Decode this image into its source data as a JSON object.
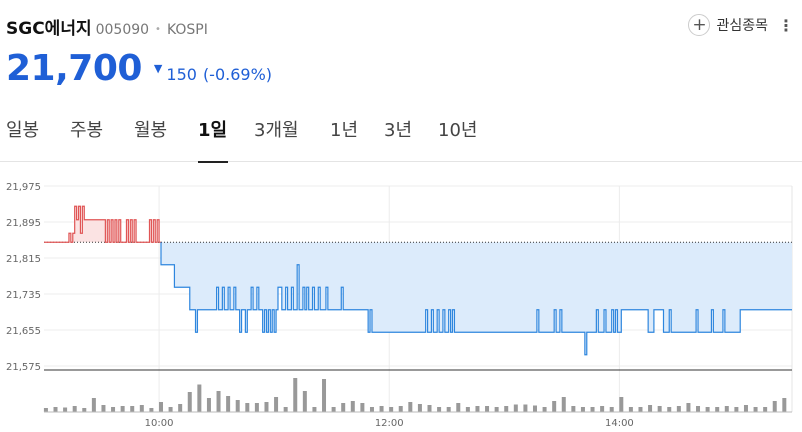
{
  "stock": {
    "name": "SGC에너지",
    "code": "005090",
    "market": "KOSPI",
    "favorite_label": "관심종목"
  },
  "price": {
    "current": "21,700",
    "change": "150",
    "change_pct": "(-0.69%)",
    "direction": "down"
  },
  "tabs": [
    {
      "label": "일봉",
      "active": false
    },
    {
      "label": "주봉",
      "active": false
    },
    {
      "label": "월봉",
      "active": false
    },
    {
      "label": "1일",
      "active": true
    },
    {
      "label": "3개월",
      "active": false
    },
    {
      "label": "1년",
      "active": false
    },
    {
      "label": "3년",
      "active": false
    },
    {
      "label": "10년",
      "active": false
    }
  ],
  "colors": {
    "price_blue": "#1f5fd6",
    "up_red": "#e05555",
    "down_blue": "#2e86de",
    "fill_blue": "#dcebfb",
    "fill_red": "#fbe3e3",
    "volume": "#999999"
  },
  "chart_data": {
    "type": "line",
    "previous_close": 21850,
    "y_ticks": [
      "21,975",
      "21,895",
      "21,815",
      "21,735",
      "21,655",
      "21,575"
    ],
    "y_tick_values": [
      21975,
      21895,
      21815,
      21735,
      21655,
      21575
    ],
    "ylim": [
      21575,
      21975
    ],
    "x_ticks": [
      "10:00",
      "12:00",
      "14:00"
    ],
    "x_tick_minutes": [
      600,
      720,
      840
    ],
    "xlim": [
      540,
      930
    ],
    "series": [
      {
        "points": [
          [
            540,
            21850
          ],
          [
            553,
            21850
          ],
          [
            553,
            21870
          ],
          [
            554,
            21870
          ],
          [
            554,
            21850
          ],
          [
            555,
            21850
          ],
          [
            555,
            21870
          ],
          [
            556,
            21870
          ],
          [
            556,
            21930
          ],
          [
            557,
            21930
          ],
          [
            557,
            21900
          ],
          [
            558,
            21900
          ],
          [
            558,
            21930
          ],
          [
            559,
            21930
          ],
          [
            559,
            21870
          ],
          [
            560,
            21870
          ],
          [
            560,
            21930
          ],
          [
            561,
            21930
          ],
          [
            561,
            21900
          ],
          [
            572,
            21900
          ],
          [
            572,
            21850
          ],
          [
            573,
            21850
          ],
          [
            573,
            21900
          ],
          [
            574,
            21900
          ],
          [
            574,
            21850
          ],
          [
            575,
            21850
          ],
          [
            575,
            21900
          ],
          [
            576,
            21900
          ],
          [
            576,
            21850
          ],
          [
            577,
            21850
          ],
          [
            577,
            21900
          ],
          [
            578,
            21900
          ],
          [
            578,
            21850
          ],
          [
            579,
            21850
          ],
          [
            579,
            21900
          ],
          [
            580,
            21900
          ],
          [
            580,
            21850
          ],
          [
            583,
            21850
          ],
          [
            583,
            21900
          ],
          [
            584,
            21900
          ],
          [
            584,
            21850
          ],
          [
            585,
            21850
          ],
          [
            585,
            21900
          ],
          [
            586,
            21900
          ],
          [
            586,
            21850
          ],
          [
            587,
            21850
          ],
          [
            587,
            21900
          ],
          [
            588,
            21900
          ],
          [
            588,
            21850
          ],
          [
            595,
            21850
          ],
          [
            595,
            21900
          ],
          [
            596,
            21900
          ],
          [
            596,
            21850
          ],
          [
            597,
            21850
          ],
          [
            597,
            21900
          ],
          [
            598,
            21900
          ],
          [
            598,
            21850
          ],
          [
            599,
            21850
          ],
          [
            599,
            21900
          ],
          [
            600,
            21900
          ],
          [
            600,
            21850
          ],
          [
            601,
            21850
          ],
          [
            601,
            21800
          ],
          [
            608,
            21800
          ],
          [
            608,
            21750
          ],
          [
            616,
            21750
          ],
          [
            616,
            21700
          ],
          [
            619,
            21700
          ],
          [
            619,
            21650
          ],
          [
            620,
            21650
          ],
          [
            620,
            21700
          ],
          [
            630,
            21700
          ],
          [
            630,
            21750
          ],
          [
            631,
            21750
          ],
          [
            631,
            21700
          ],
          [
            633,
            21700
          ],
          [
            633,
            21750
          ],
          [
            634,
            21750
          ],
          [
            634,
            21700
          ],
          [
            636,
            21700
          ],
          [
            636,
            21750
          ],
          [
            637,
            21750
          ],
          [
            637,
            21700
          ],
          [
            639,
            21700
          ],
          [
            639,
            21750
          ],
          [
            640,
            21750
          ],
          [
            640,
            21700
          ],
          [
            642,
            21700
          ],
          [
            642,
            21650
          ],
          [
            643,
            21650
          ],
          [
            643,
            21700
          ],
          [
            645,
            21700
          ],
          [
            645,
            21650
          ],
          [
            646,
            21650
          ],
          [
            646,
            21700
          ],
          [
            648,
            21700
          ],
          [
            648,
            21750
          ],
          [
            649,
            21750
          ],
          [
            649,
            21700
          ],
          [
            651,
            21700
          ],
          [
            651,
            21750
          ],
          [
            652,
            21750
          ],
          [
            652,
            21700
          ],
          [
            654,
            21700
          ],
          [
            654,
            21650
          ],
          [
            655,
            21650
          ],
          [
            655,
            21700
          ],
          [
            656,
            21700
          ],
          [
            656,
            21650
          ],
          [
            657,
            21650
          ],
          [
            657,
            21700
          ],
          [
            658,
            21700
          ],
          [
            658,
            21650
          ],
          [
            659,
            21650
          ],
          [
            659,
            21700
          ],
          [
            660,
            21700
          ],
          [
            660,
            21650
          ],
          [
            661,
            21650
          ],
          [
            661,
            21700
          ],
          [
            662,
            21700
          ],
          [
            662,
            21750
          ],
          [
            664,
            21750
          ],
          [
            664,
            21700
          ],
          [
            666,
            21700
          ],
          [
            666,
            21750
          ],
          [
            667,
            21750
          ],
          [
            667,
            21700
          ],
          [
            669,
            21700
          ],
          [
            669,
            21750
          ],
          [
            670,
            21750
          ],
          [
            670,
            21700
          ],
          [
            672,
            21700
          ],
          [
            672,
            21800
          ],
          [
            673,
            21800
          ],
          [
            673,
            21700
          ],
          [
            675,
            21700
          ],
          [
            675,
            21750
          ],
          [
            676,
            21750
          ],
          [
            676,
            21700
          ],
          [
            677,
            21700
          ],
          [
            677,
            21750
          ],
          [
            678,
            21750
          ],
          [
            678,
            21700
          ],
          [
            680,
            21700
          ],
          [
            680,
            21750
          ],
          [
            681,
            21750
          ],
          [
            681,
            21700
          ],
          [
            683,
            21700
          ],
          [
            683,
            21750
          ],
          [
            684,
            21750
          ],
          [
            684,
            21700
          ],
          [
            687,
            21700
          ],
          [
            687,
            21750
          ],
          [
            688,
            21750
          ],
          [
            688,
            21700
          ],
          [
            695,
            21700
          ],
          [
            695,
            21750
          ],
          [
            696,
            21750
          ],
          [
            696,
            21700
          ],
          [
            709,
            21700
          ],
          [
            709,
            21650
          ],
          [
            710,
            21650
          ],
          [
            710,
            21700
          ],
          [
            711,
            21700
          ],
          [
            711,
            21650
          ],
          [
            739,
            21650
          ],
          [
            739,
            21700
          ],
          [
            740,
            21700
          ],
          [
            740,
            21650
          ],
          [
            742,
            21650
          ],
          [
            742,
            21700
          ],
          [
            743,
            21700
          ],
          [
            743,
            21650
          ],
          [
            745,
            21650
          ],
          [
            745,
            21700
          ],
          [
            746,
            21700
          ],
          [
            746,
            21650
          ],
          [
            748,
            21650
          ],
          [
            748,
            21700
          ],
          [
            749,
            21700
          ],
          [
            749,
            21650
          ],
          [
            751,
            21650
          ],
          [
            751,
            21700
          ],
          [
            752,
            21700
          ],
          [
            752,
            21650
          ],
          [
            753,
            21650
          ],
          [
            753,
            21700
          ],
          [
            754,
            21700
          ],
          [
            754,
            21650
          ],
          [
            797,
            21650
          ],
          [
            797,
            21700
          ],
          [
            798,
            21700
          ],
          [
            798,
            21650
          ],
          [
            806,
            21650
          ],
          [
            806,
            21700
          ],
          [
            807,
            21700
          ],
          [
            807,
            21650
          ],
          [
            809,
            21650
          ],
          [
            809,
            21700
          ],
          [
            810,
            21700
          ],
          [
            810,
            21650
          ],
          [
            822,
            21650
          ],
          [
            822,
            21600
          ],
          [
            823,
            21600
          ],
          [
            823,
            21650
          ],
          [
            828,
            21650
          ],
          [
            828,
            21700
          ],
          [
            829,
            21700
          ],
          [
            829,
            21650
          ],
          [
            832,
            21650
          ],
          [
            832,
            21700
          ],
          [
            833,
            21700
          ],
          [
            833,
            21650
          ],
          [
            836,
            21650
          ],
          [
            836,
            21700
          ],
          [
            837,
            21700
          ],
          [
            837,
            21650
          ],
          [
            838,
            21650
          ],
          [
            838,
            21700
          ],
          [
            839,
            21700
          ],
          [
            839,
            21650
          ],
          [
            841,
            21650
          ],
          [
            841,
            21700
          ],
          [
            855,
            21700
          ],
          [
            855,
            21650
          ],
          [
            858,
            21650
          ],
          [
            858,
            21700
          ],
          [
            863,
            21700
          ],
          [
            863,
            21650
          ],
          [
            866,
            21650
          ],
          [
            866,
            21700
          ],
          [
            867,
            21700
          ],
          [
            867,
            21650
          ],
          [
            880,
            21650
          ],
          [
            880,
            21700
          ],
          [
            881,
            21700
          ],
          [
            881,
            21650
          ],
          [
            888,
            21650
          ],
          [
            888,
            21700
          ],
          [
            889,
            21700
          ],
          [
            889,
            21650
          ],
          [
            894,
            21650
          ],
          [
            894,
            21700
          ],
          [
            895,
            21700
          ],
          [
            895,
            21650
          ],
          [
            903,
            21650
          ],
          [
            903,
            21700
          ],
          [
            930,
            21700
          ]
        ]
      }
    ],
    "volume": {
      "x": [
        541,
        546,
        551,
        556,
        561,
        566,
        571,
        576,
        581,
        586,
        591,
        596,
        601,
        606,
        611,
        616,
        621,
        626,
        631,
        636,
        641,
        646,
        651,
        656,
        661,
        666,
        671,
        676,
        681,
        686,
        691,
        696,
        701,
        706,
        711,
        716,
        721,
        726,
        731,
        736,
        741,
        746,
        751,
        756,
        761,
        766,
        771,
        776,
        781,
        786,
        791,
        796,
        801,
        806,
        811,
        816,
        821,
        826,
        831,
        836,
        841,
        846,
        851,
        856,
        861,
        866,
        871,
        876,
        881,
        886,
        891,
        896,
        901,
        906,
        911,
        916,
        921,
        926
      ],
      "values": [
        8,
        10,
        9,
        12,
        8,
        28,
        14,
        10,
        12,
        12,
        14,
        8,
        20,
        10,
        16,
        40,
        55,
        28,
        42,
        32,
        24,
        18,
        18,
        20,
        30,
        10,
        68,
        42,
        10,
        66,
        10,
        18,
        22,
        18,
        10,
        12,
        10,
        12,
        20,
        16,
        14,
        10,
        10,
        18,
        10,
        12,
        12,
        10,
        12,
        15,
        15,
        13,
        10,
        22,
        30,
        12,
        10,
        10,
        12,
        10,
        30,
        10,
        10,
        14,
        12,
        10,
        12,
        18,
        12,
        10,
        10,
        12,
        10,
        14,
        10,
        10,
        22,
        28
      ]
    }
  }
}
